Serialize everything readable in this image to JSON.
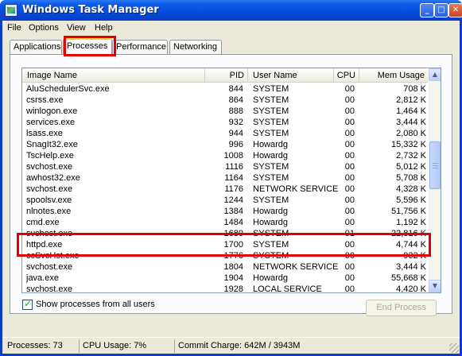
{
  "window": {
    "title": "Windows Task Manager"
  },
  "titlebar_buttons": {
    "minimize": "_",
    "maximize": "□",
    "close": "✕"
  },
  "menu": [
    "File",
    "Options",
    "View",
    "Help"
  ],
  "tabs": [
    {
      "label": "Applications",
      "active": false
    },
    {
      "label": "Processes",
      "active": true
    },
    {
      "label": "Performance",
      "active": false
    },
    {
      "label": "Networking",
      "active": false
    }
  ],
  "columns": [
    "Image Name",
    "PID",
    "User Name",
    "CPU",
    "Mem Usage"
  ],
  "processes": [
    {
      "name": "AluSchedulerSvc.exe",
      "pid": "844",
      "user": "SYSTEM",
      "cpu": "00",
      "mem": "708 K"
    },
    {
      "name": "csrss.exe",
      "pid": "864",
      "user": "SYSTEM",
      "cpu": "00",
      "mem": "2,812 K"
    },
    {
      "name": "winlogon.exe",
      "pid": "888",
      "user": "SYSTEM",
      "cpu": "00",
      "mem": "1,464 K"
    },
    {
      "name": "services.exe",
      "pid": "932",
      "user": "SYSTEM",
      "cpu": "00",
      "mem": "3,444 K"
    },
    {
      "name": "lsass.exe",
      "pid": "944",
      "user": "SYSTEM",
      "cpu": "00",
      "mem": "2,080 K"
    },
    {
      "name": "SnagIt32.exe",
      "pid": "996",
      "user": "Howardg",
      "cpu": "00",
      "mem": "15,332 K"
    },
    {
      "name": "TscHelp.exe",
      "pid": "1008",
      "user": "Howardg",
      "cpu": "00",
      "mem": "2,732 K"
    },
    {
      "name": "svchost.exe",
      "pid": "1116",
      "user": "SYSTEM",
      "cpu": "00",
      "mem": "5,012 K"
    },
    {
      "name": "awhost32.exe",
      "pid": "1164",
      "user": "SYSTEM",
      "cpu": "00",
      "mem": "5,708 K"
    },
    {
      "name": "svchost.exe",
      "pid": "1176",
      "user": "NETWORK SERVICE",
      "cpu": "00",
      "mem": "4,328 K"
    },
    {
      "name": "spoolsv.exe",
      "pid": "1244",
      "user": "SYSTEM",
      "cpu": "00",
      "mem": "5,596 K"
    },
    {
      "name": "nlnotes.exe",
      "pid": "1384",
      "user": "Howardg",
      "cpu": "00",
      "mem": "51,756 K"
    },
    {
      "name": "cmd.exe",
      "pid": "1484",
      "user": "Howardg",
      "cpu": "00",
      "mem": "1,192 K"
    },
    {
      "name": "svchost.exe",
      "pid": "1680",
      "user": "SYSTEM",
      "cpu": "01",
      "mem": "22,816 K"
    },
    {
      "name": "httpd.exe",
      "pid": "1700",
      "user": "SYSTEM",
      "cpu": "00",
      "mem": "4,744 K"
    },
    {
      "name": "ccSvcHst.exe",
      "pid": "1776",
      "user": "SYSTEM",
      "cpu": "00",
      "mem": "932 K"
    },
    {
      "name": "svchost.exe",
      "pid": "1804",
      "user": "NETWORK SERVICE",
      "cpu": "00",
      "mem": "3,444 K"
    },
    {
      "name": "java.exe",
      "pid": "1904",
      "user": "Howardg",
      "cpu": "00",
      "mem": "55,668 K"
    },
    {
      "name": "svchost.exe",
      "pid": "1928",
      "user": "LOCAL SERVICE",
      "cpu": "00",
      "mem": "4,420 K"
    }
  ],
  "show_all_label": "Show processes from all users",
  "show_all_checked": true,
  "end_process_label": "End Process",
  "status": {
    "processes": "Processes: 73",
    "cpu": "CPU Usage: 7%",
    "commit": "Commit Charge: 642M / 3943M"
  },
  "colors": {
    "highlight": "#e00000",
    "titlebar": "#0a3fc2"
  }
}
